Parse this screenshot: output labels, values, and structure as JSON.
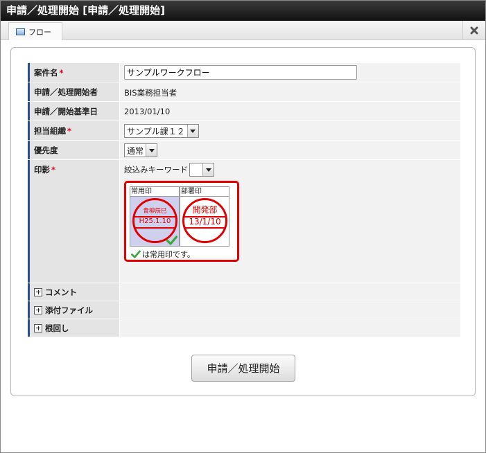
{
  "window": {
    "title": "申請／処理開始 [申請／処理開始]"
  },
  "tabs": [
    {
      "label": "フロー",
      "icon": "window-icon"
    }
  ],
  "close_icon": "close-icon",
  "form": {
    "matter_name": {
      "label": "案件名",
      "required_mark": "*",
      "value": "サンプルワークフロー"
    },
    "applicant": {
      "label": "申請／処理開始者",
      "value": "BIS業務担当者"
    },
    "base_date": {
      "label": "申請／開始基準日",
      "value": "2013/01/10"
    },
    "org": {
      "label": "担当組織",
      "required_mark": "*",
      "selected": "サンプル課１２"
    },
    "priority": {
      "label": "優先度",
      "selected": "通常"
    },
    "stamp": {
      "label": "印影",
      "required_mark": "*",
      "keyword_label": "絞込みキーワード",
      "keyword_selected": "",
      "stamps": [
        {
          "header": "常用印",
          "top_text": "青柳辰巳",
          "mid_text": "H25.1.10",
          "selected": true
        },
        {
          "header": "部署印",
          "top_text": "開発部",
          "mid_text": "13/1/10",
          "selected": false
        }
      ],
      "note": "は常用印です。",
      "accent_color": "#e00000"
    },
    "collapsibles": [
      {
        "label": "コメント"
      },
      {
        "label": "添付ファイル"
      },
      {
        "label": "根回し"
      }
    ]
  },
  "submit": {
    "label": "申請／処理開始"
  },
  "colors": {
    "label_border": "#2c4f8f",
    "required": "#e0001b",
    "check": "#3aa83a"
  }
}
